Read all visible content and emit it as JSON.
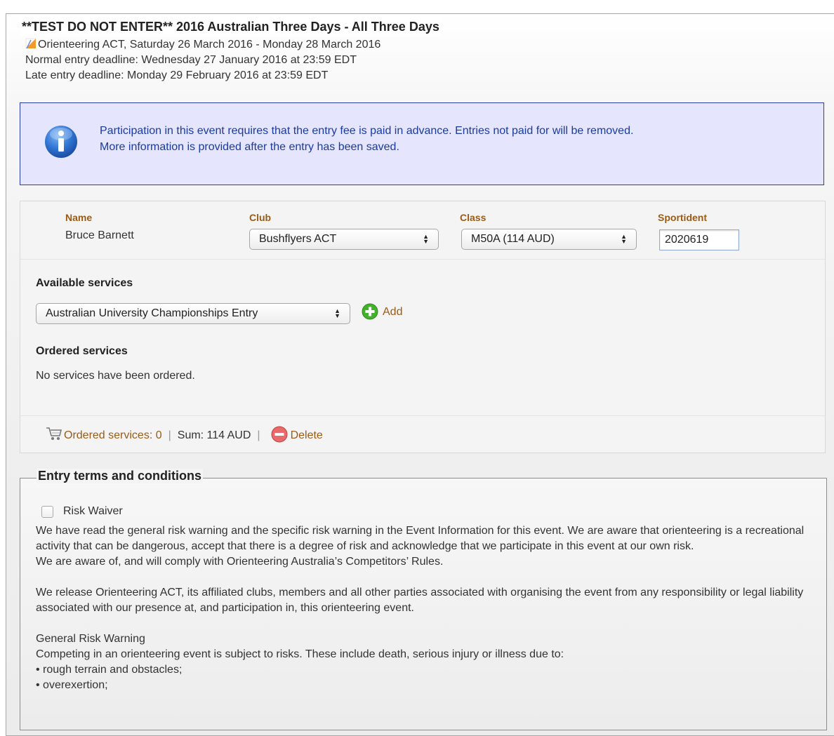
{
  "event": {
    "title": "**TEST DO NOT ENTER** 2016 Australian Three Days - All Three Days",
    "organiser_line": "Orienteering ACT, Saturday 26 March 2016 - Monday 28 March 2016",
    "normal_deadline": "Normal entry deadline: Wednesday 27 January 2016 at 23:59 EDT",
    "late_deadline": "Late entry deadline: Monday 29 February 2016 at 23:59 EDT"
  },
  "info": {
    "icon": "info-icon",
    "line1": "Participation in this event requires that the entry fee is paid in advance. Entries not paid for will be removed.",
    "line2": "More information is provided after the entry has been saved."
  },
  "entry": {
    "name_label": "Name",
    "name_value": "Bruce Barnett",
    "club_label": "Club",
    "club_value": "Bushflyers ACT",
    "class_label": "Class",
    "class_value": "M50A (114 AUD)",
    "sportident_label": "Sportident",
    "sportident_value": "2020619",
    "available_services_heading": "Available services",
    "service_select_value": "Australian University Championships Entry",
    "add_label": "Add",
    "ordered_services_heading": "Ordered services",
    "no_services_text": "No services have been ordered."
  },
  "footer": {
    "ordered_services": "Ordered services: 0",
    "sum": "Sum: 114 AUD",
    "delete_label": "Delete"
  },
  "terms": {
    "title": "Entry terms and conditions",
    "checkbox_label": "Risk Waiver",
    "checked": false,
    "para1": "We have read the general risk warning and the specific risk warning in the Event Information for this event. We are aware that orienteering is a recreational activity that can be dangerous, accept that there is a degree of risk and acknowledge that we participate in this event at our own risk.",
    "para2": "We are aware of, and will comply with Orienteering Australia’s Competitors’ Rules.",
    "para3": "We release Orienteering ACT, its affiliated clubs, members and all other parties associated with organising the event from any responsibility or legal liability associated with our presence at, and participation in, this orienteering event.",
    "risk_heading": "General Risk Warning",
    "risk_intro": "Competing in an orienteering event is subject to risks. These include death, serious injury or illness due to:",
    "risk_items": [
      "• rough terrain and obstacles;",
      "• overexertion;"
    ]
  },
  "colors": {
    "label_brown": "#9b5b16",
    "info_border": "#2b3ea5",
    "info_background": "#e5e5fd",
    "info_text": "#1b3b9e",
    "add_green": "#43b12c",
    "delete_red": "#d9534f"
  }
}
